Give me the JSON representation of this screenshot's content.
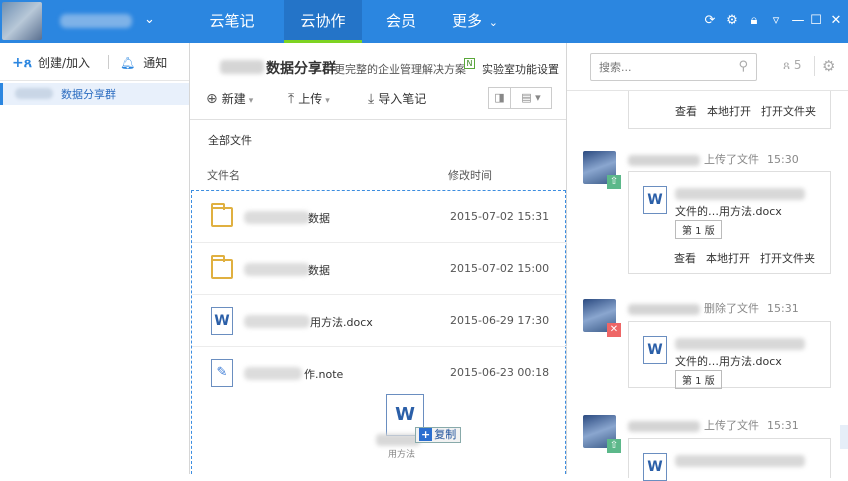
{
  "topbar": {
    "tabs": [
      {
        "label": "云笔记"
      },
      {
        "label": "云协作"
      },
      {
        "label": "会员"
      },
      {
        "label": "更多"
      }
    ],
    "more_caret": "⌄"
  },
  "sidebar": {
    "create_label": "创建/加入",
    "notice_label": "通知",
    "group_label": "数据分享群"
  },
  "middle": {
    "group_title": "数据分享群",
    "group_subtitle": "更完整的企业管理解决方案",
    "lab_label": "实验室功能设置",
    "toolbar": {
      "new_label": "新建",
      "upload_label": "上传",
      "import_label": "导入笔记"
    },
    "breadcrumb": "全部文件",
    "columns": {
      "name": "文件名",
      "time": "修改时间"
    },
    "files": [
      {
        "type": "folder",
        "name_suffix": "数据",
        "time": "2015-07-02 15:31"
      },
      {
        "type": "folder",
        "name_suffix": "数据",
        "time": "2015-07-02 15:00"
      },
      {
        "type": "docx",
        "name_suffix": "用方法.docx",
        "time": "2015-06-29 17:30"
      },
      {
        "type": "note",
        "name_suffix": "作.note",
        "time": "2015-06-23 00:18"
      }
    ],
    "drag": {
      "copy_label": "复制",
      "sub_label": "用方法"
    }
  },
  "right": {
    "search_placeholder": "搜索...",
    "member_count": "5",
    "top_card_actions": [
      "查看",
      "本地打开",
      "打开文件夹"
    ],
    "feed": [
      {
        "action": "上传了文件",
        "time": "15:30",
        "version": "第 1 版",
        "file_text": "文件的…用方法.docx",
        "actions": [
          "查看",
          "本地打开",
          "打开文件夹"
        ]
      },
      {
        "action": "删除了文件",
        "time": "15:31",
        "version": "第 1 版",
        "file_text": "文件的…用方法.docx"
      },
      {
        "action": "上传了文件",
        "time": "15:31"
      }
    ]
  }
}
